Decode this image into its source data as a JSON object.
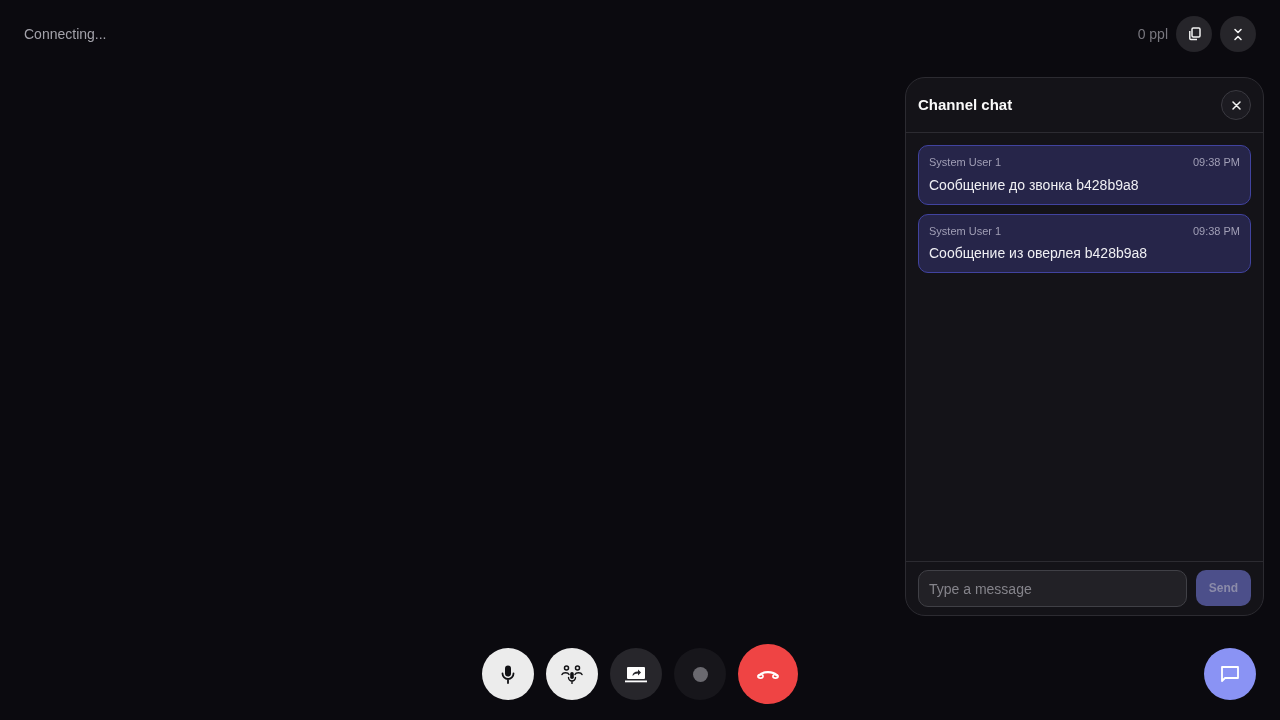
{
  "top_bar": {
    "status": "Connecting...",
    "participants": "0 ppl"
  },
  "chat": {
    "title": "Channel chat",
    "messages": [
      {
        "author": "System User 1",
        "time": "09:38 PM",
        "text": "Сообщение до звонка b428b9a8"
      },
      {
        "author": "System User 1",
        "time": "09:38 PM",
        "text": "Сообщение из оверлея b428b9a8"
      }
    ],
    "input": {
      "placeholder": "Type a message"
    },
    "send": {
      "label": "Send",
      "disabled": true
    }
  },
  "controls": [
    {
      "kind": "mic",
      "on": true,
      "disabled": false
    },
    {
      "kind": "voice",
      "on": true,
      "disabled": false
    },
    {
      "kind": "screen",
      "on": false,
      "disabled": false
    },
    {
      "kind": "record",
      "on": false,
      "disabled": true
    }
  ]
}
